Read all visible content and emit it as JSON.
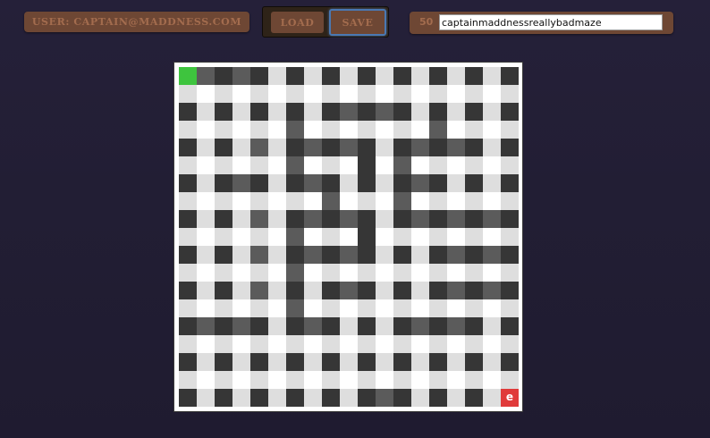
{
  "user": {
    "label": "USER: CAPTAIN@MADDNESS.COM"
  },
  "toolbar": {
    "load_label": "LOAD",
    "save_label": "SAVE"
  },
  "seed": {
    "size": "50",
    "value": "captainmaddnessreallybadmaze"
  },
  "maze": {
    "rows": 19,
    "cols": 19,
    "start": [
      0,
      0
    ],
    "goal": [
      18,
      18
    ],
    "goal_label": "e",
    "colors": {
      "0": "#ffffff",
      "1": "#dedede",
      "2": "#5b5b5b",
      "3": "#363636",
      "start": "#3ec43e",
      "goal": "#e03a3a"
    },
    "cells": [
      "S232313131313131313",
      "1010101010101010101",
      "3131313132323131313",
      "1010102010101020101",
      "3131213232313232313",
      "1010102010302010101",
      "3132313231313231313",
      "1010101020102010101",
      "3131213232313232323",
      "1010102010301010101",
      "3131213232313132323",
      "1010102010101010101",
      "3131213132313132323",
      "1010102010101010101",
      "3232313231313232313",
      "1010101010101010101",
      "3131313131313131313",
      "1010101010101010101",
      "313131313132313131G"
    ]
  }
}
